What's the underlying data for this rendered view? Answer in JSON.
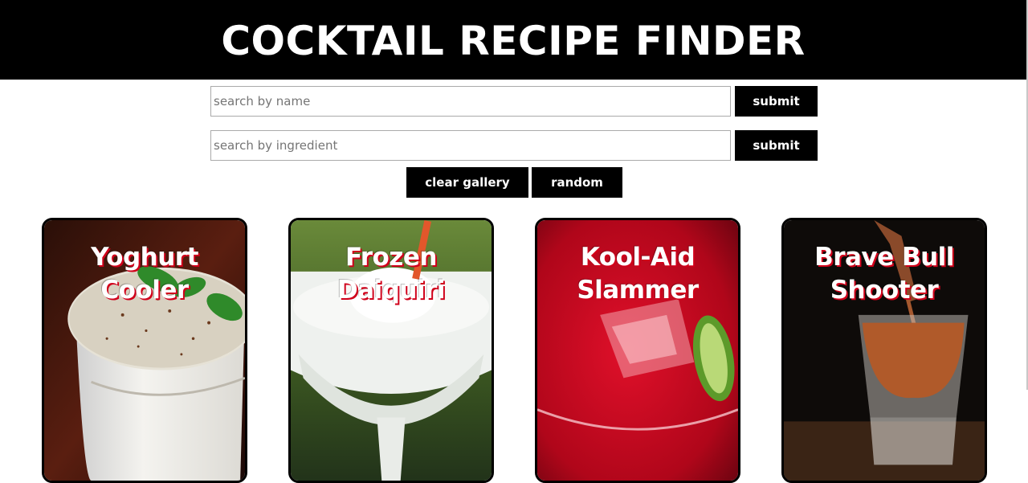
{
  "header": {
    "title": "COCKTAIL RECIPE FINDER"
  },
  "search_name": {
    "placeholder": "search by name",
    "submit_label": "submit"
  },
  "search_ingredient": {
    "placeholder": "search by ingredient",
    "submit_label": "submit"
  },
  "actions": {
    "clear_label": "clear gallery",
    "random_label": "random"
  },
  "colors": {
    "header_bg": "#000000",
    "button_bg": "#000000",
    "title_shadow": "#d0001a"
  },
  "gallery": [
    {
      "name": "Yoghurt Cooler"
    },
    {
      "name": "Frozen Daiquiri"
    },
    {
      "name": "Kool-Aid Slammer"
    },
    {
      "name": "Brave Bull Shooter"
    }
  ]
}
